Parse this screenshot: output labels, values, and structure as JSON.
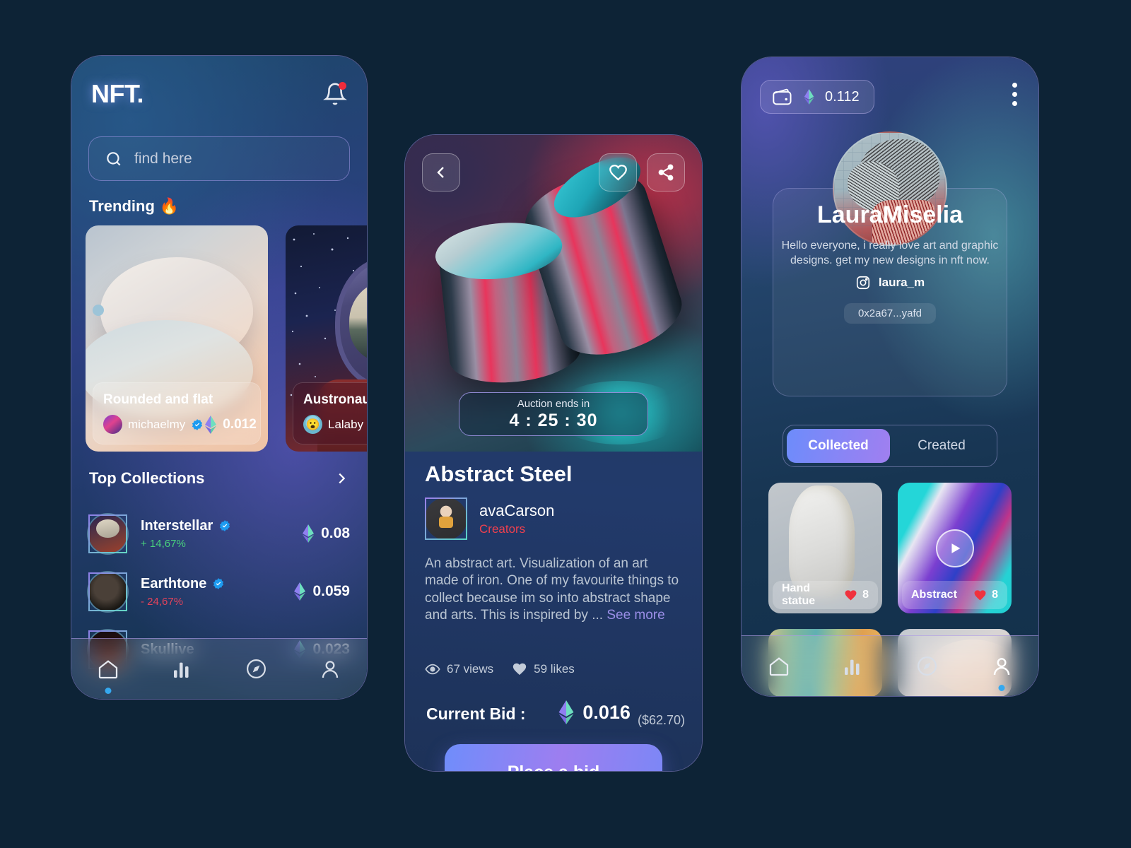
{
  "phone1": {
    "logo": "NFT.",
    "notification_icon": "bell-icon",
    "search": {
      "placeholder": "find here",
      "icon": "search-icon"
    },
    "trending": {
      "title": "Trending",
      "emoji": "🔥",
      "cards": [
        {
          "name": "Rounded and flat",
          "user": "michaelmy",
          "verified": true,
          "price": "0.012",
          "currency_icon": "ethereum-icon"
        },
        {
          "name": "Austronaut",
          "user": "Lalaby",
          "verified": false,
          "price": "",
          "currency_icon": "ethereum-icon"
        }
      ]
    },
    "collections": {
      "title": "Top Collections",
      "more_icon": "chevron-right-icon",
      "items": [
        {
          "name": "Interstellar",
          "verified": true,
          "change": "+ 14,67%",
          "direction": "up",
          "price": "0.08"
        },
        {
          "name": "Earthtone",
          "verified": true,
          "change": "- 24,67%",
          "direction": "down",
          "price": "0.059"
        },
        {
          "name": "Skullive",
          "verified": false,
          "change": "",
          "direction": "up",
          "price": "0.023"
        }
      ]
    },
    "nav": [
      {
        "icon": "home-icon",
        "active": true
      },
      {
        "icon": "stats-icon",
        "active": false
      },
      {
        "icon": "compass-icon",
        "active": false
      },
      {
        "icon": "profile-icon",
        "active": false
      }
    ]
  },
  "phone2": {
    "back_icon": "chevron-left-icon",
    "like_icon": "heart-icon",
    "share_icon": "share-icon",
    "auction": {
      "label": "Auction ends in",
      "time": "4 : 25 : 30"
    },
    "title": "Abstract Steel",
    "creator": {
      "name": "avaCarson",
      "role": "Creators"
    },
    "description": "An abstract art. Visualization of an art made of iron. One of my favourite things to collect because im so into abstract shape and arts. This is inspired by ...",
    "see_more": "See more",
    "stats": {
      "views": "67 views",
      "likes": "59 likes",
      "views_icon": "eye-icon",
      "likes_icon": "heart-icon"
    },
    "bid": {
      "label": "Current Bid :",
      "eth": "0.016",
      "usd": "($62.70)",
      "currency_icon": "ethereum-icon"
    },
    "bid_button": "Place a bid"
  },
  "phone3": {
    "wallet": {
      "icon": "wallet-icon",
      "currency_icon": "ethereum-icon",
      "balance": "0.112"
    },
    "menu_icon": "kebab-menu-icon",
    "profile": {
      "avatar_icon": "user-avatar",
      "name": "LauraMiselia",
      "bio": "Hello everyone, i really love art and graphic designs. get my new designs in nft now.",
      "instagram_icon": "instagram-icon",
      "instagram": "laura_m",
      "address": "0x2a67...yafd"
    },
    "tabs": [
      {
        "label": "Collected",
        "active": true
      },
      {
        "label": "Created",
        "active": false
      }
    ],
    "nfts": [
      {
        "name": "Hand statue",
        "likes": "8",
        "art": "hand",
        "video": false
      },
      {
        "name": "Abstract",
        "likes": "8",
        "art": "abstract",
        "video": true
      },
      {
        "name": "",
        "likes": "",
        "art": "brush",
        "video": false
      },
      {
        "name": "",
        "likes": "",
        "art": "soft",
        "video": false
      }
    ],
    "nav": [
      {
        "icon": "home-icon",
        "active": false
      },
      {
        "icon": "stats-icon",
        "active": false
      },
      {
        "icon": "compass-icon",
        "active": false
      },
      {
        "icon": "profile-icon",
        "active": true
      }
    ]
  },
  "colors": {
    "accent_blue": "#35a8ef",
    "accent_purple": "#9d7ef0",
    "up_green": "#49d17d",
    "down_red": "#e2435b",
    "role_red": "#f0404e",
    "verified_blue": "#1d9bf0",
    "like_red": "#f0323e"
  }
}
